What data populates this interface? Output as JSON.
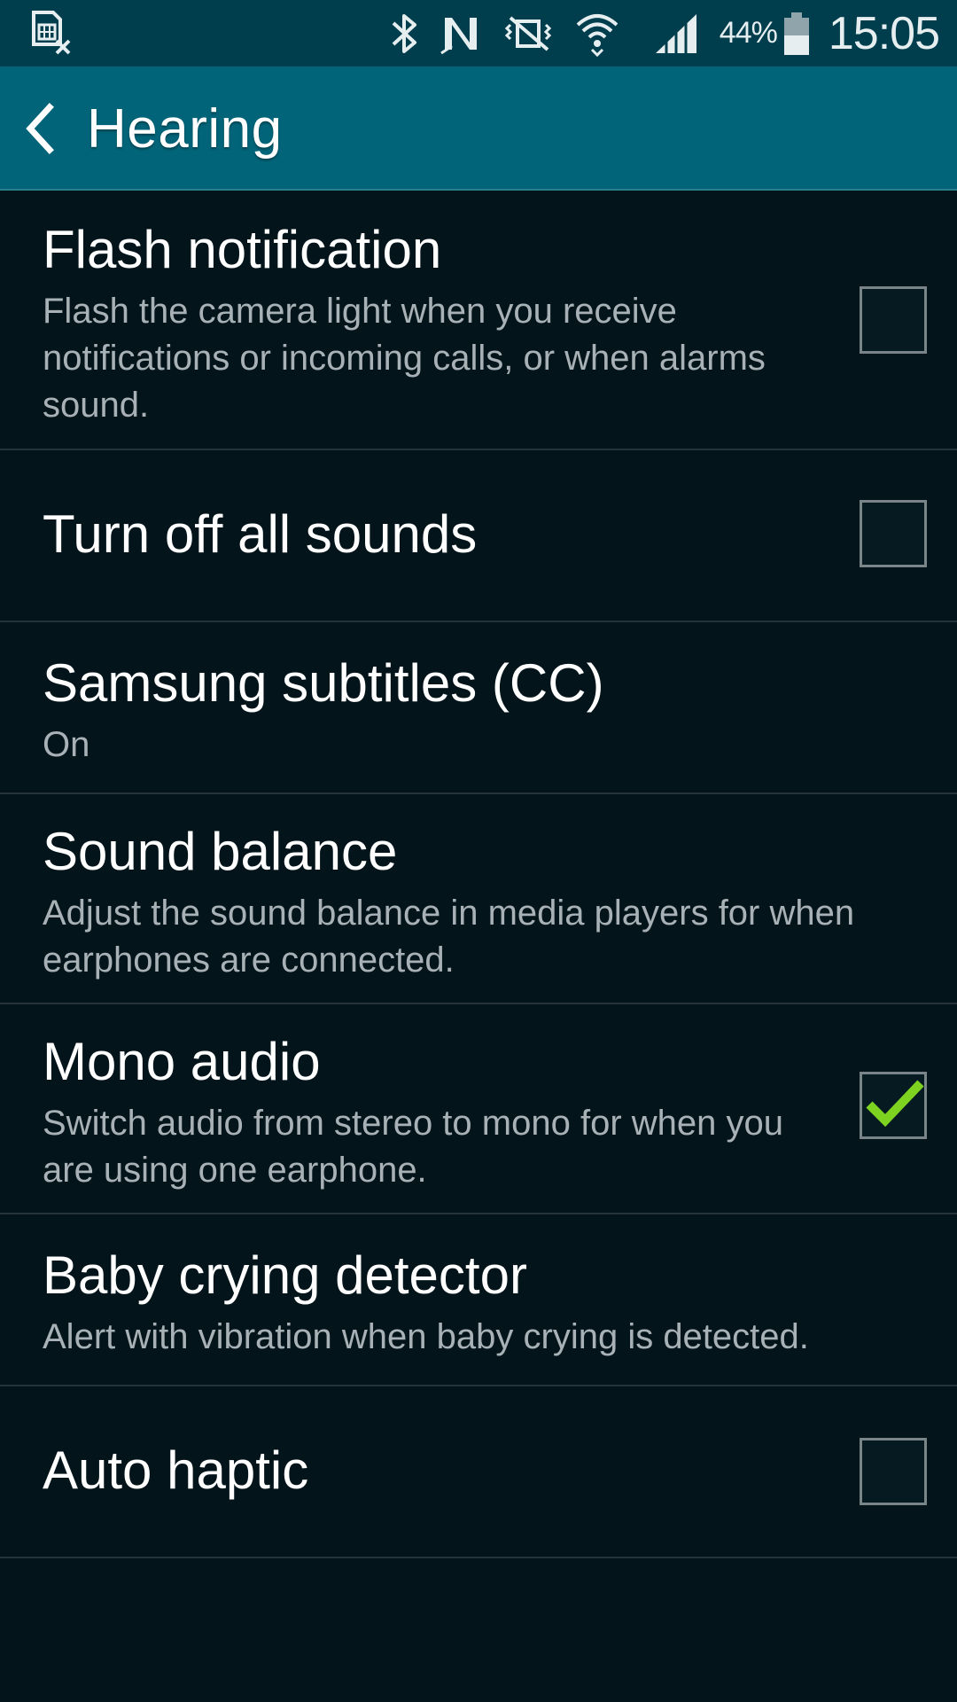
{
  "status_bar": {
    "icons": [
      "sim-card-no-service-icon",
      "bluetooth-icon",
      "nfc-icon",
      "vibrate-mute-icon",
      "wifi-icon",
      "signal-icon",
      "battery-icon"
    ],
    "battery_percent": "44%",
    "time": "15:05"
  },
  "header": {
    "title": "Hearing",
    "back_icon": "chevron-left-icon"
  },
  "settings": [
    {
      "title": "Flash notification",
      "summary": "Flash the camera light when you receive notifications or incoming calls, or when alarms sound.",
      "checkbox": true,
      "checked": false
    },
    {
      "title": "Turn off all sounds",
      "summary": "",
      "checkbox": true,
      "checked": false
    },
    {
      "title": "Samsung subtitles (CC)",
      "summary": "On",
      "checkbox": false,
      "checked": false
    },
    {
      "title": "Sound balance",
      "summary": "Adjust the sound balance in media players for when earphones are connected.",
      "checkbox": false,
      "checked": false
    },
    {
      "title": "Mono audio",
      "summary": "Switch audio from stereo to mono for when you are using one earphone.",
      "checkbox": true,
      "checked": true
    },
    {
      "title": "Baby crying detector",
      "summary": "Alert with vibration when baby crying is detected.",
      "checkbox": false,
      "checked": false
    },
    {
      "title": "Auto haptic",
      "summary": "",
      "checkbox": true,
      "checked": false
    }
  ],
  "colors": {
    "status_bar_bg": "#003e4e",
    "action_bar_bg": "#016478",
    "list_bg": "#04141b",
    "checkmark": "#7ed321"
  }
}
